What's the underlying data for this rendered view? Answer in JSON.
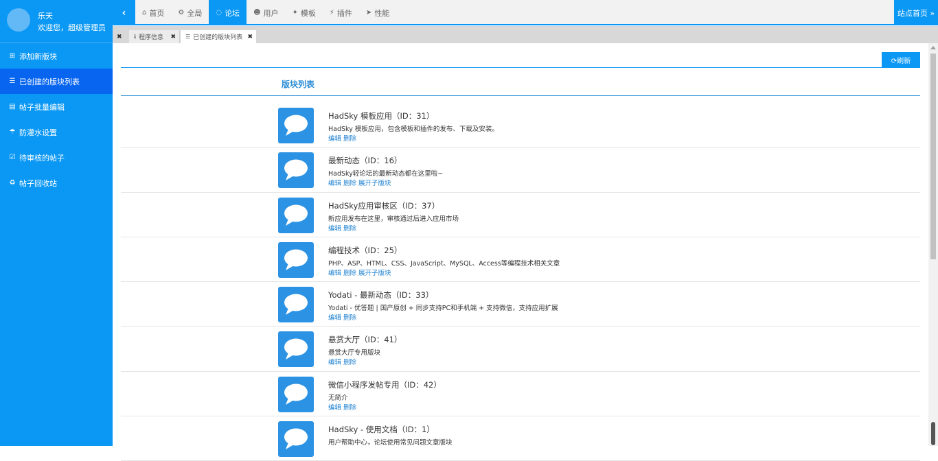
{
  "user": {
    "name": "乐天",
    "welcome": "欢迎您，超级管理员"
  },
  "sidebar": {
    "items": [
      {
        "icon": "plus-square-icon",
        "glyph": "⊞",
        "label": "添加新版块"
      },
      {
        "icon": "list-icon",
        "glyph": "☰",
        "label": "已创建的版块列表"
      },
      {
        "icon": "batch-edit-icon",
        "glyph": "▤",
        "label": "帖子批量编辑"
      },
      {
        "icon": "umbrella-icon",
        "glyph": "☂",
        "label": "防灌水设置"
      },
      {
        "icon": "check-square-icon",
        "glyph": "☑",
        "label": "待审核的帖子"
      },
      {
        "icon": "recycle-icon",
        "glyph": "♻",
        "label": "帖子回收站"
      }
    ]
  },
  "topnav": {
    "collapse": "‹",
    "items": [
      {
        "icon": "home-icon",
        "glyph": "⌂",
        "label": "首页"
      },
      {
        "icon": "gears-icon",
        "glyph": "⚙",
        "label": "全局"
      },
      {
        "icon": "comments-icon",
        "glyph": "◌",
        "label": "论坛"
      },
      {
        "icon": "users-icon",
        "glyph": "☻",
        "label": "用户"
      },
      {
        "icon": "puzzle-icon",
        "glyph": "✦",
        "label": "模板"
      },
      {
        "icon": "plug-icon",
        "glyph": "⚡",
        "label": "插件"
      },
      {
        "icon": "paper-plane-icon",
        "glyph": "➤",
        "label": "性能"
      }
    ],
    "site_home": "站点首页 »"
  },
  "tabs": {
    "close_all": "✖",
    "items": [
      {
        "glyph": "ℹ",
        "label": "程序信息",
        "close": "✖"
      },
      {
        "glyph": "☰",
        "label": "已创建的版块列表",
        "close": "✖"
      }
    ]
  },
  "content": {
    "refresh_label": "⟳刷新",
    "section_title": "版块列表",
    "forums": [
      {
        "name": "HadSky 模板应用（ID：31）",
        "desc": "HadSky 模板应用，包含模板和插件的发布、下载及安装。",
        "actions": [
          "编辑",
          "删除"
        ]
      },
      {
        "name": "最新动态（ID：16）",
        "desc": "HadSky轻论坛的最新动态都在这里啦~",
        "actions": [
          "编辑",
          "删除",
          "展开子版块"
        ]
      },
      {
        "name": "HadSky应用审核区（ID：37）",
        "desc": "新应用发布在这里，审核通过后进入应用市场",
        "actions": [
          "编辑",
          "删除"
        ]
      },
      {
        "name": "编程技术（ID：25）",
        "desc": "PHP、ASP、HTML、CSS、JavaScript、MySQL、Access等编程技术相关文章",
        "actions": [
          "编辑",
          "删除",
          "展开子版块"
        ]
      },
      {
        "name": "Yodati - 最新动态（ID：33）",
        "desc": "Yodati - 优答题 | 国产原创 + 同步支持PC和手机端 + 支持微信，支持应用扩展",
        "actions": [
          "编辑",
          "删除"
        ]
      },
      {
        "name": "悬赏大厅（ID：41）",
        "desc": "悬赏大厅专用版块",
        "actions": [
          "编辑",
          "删除"
        ]
      },
      {
        "name": "微信小程序发帖专用（ID：42）",
        "desc": "无简介",
        "actions": [
          "编辑",
          "删除"
        ]
      },
      {
        "name": "HadSky - 使用文档（ID：1）",
        "desc": "用户帮助中心，论坛使用常见问题文章版块",
        "actions": []
      }
    ]
  },
  "colors": {
    "primary": "#0b98f5",
    "active": "#0765f0",
    "link": "#1f82d1",
    "icon_bg": "#2b92e4"
  }
}
